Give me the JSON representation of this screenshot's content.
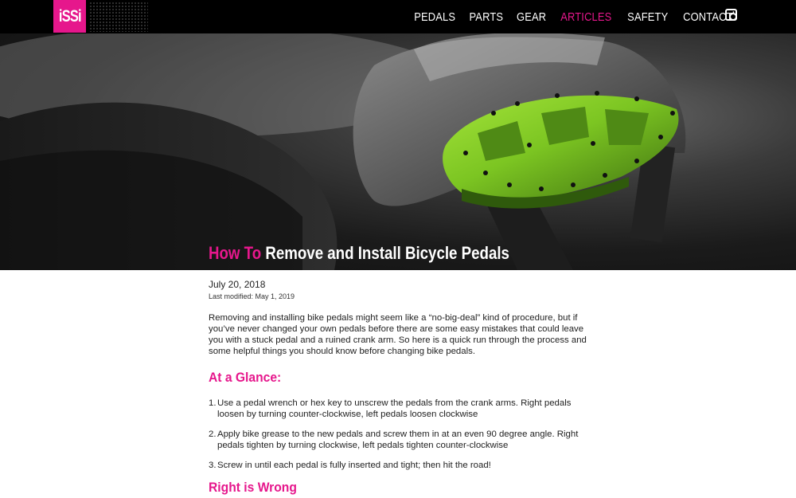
{
  "header": {
    "logo_text": "iSSi",
    "nav": [
      {
        "label": "PEDALS",
        "active": false
      },
      {
        "label": "PARTS",
        "active": false
      },
      {
        "label": "GEAR",
        "active": false
      },
      {
        "label": "ARTICLES",
        "active": true
      },
      {
        "label": "SAFETY",
        "active": false
      },
      {
        "label": "CONTACT",
        "active": false
      }
    ],
    "social_icon": "instagram-icon"
  },
  "hero": {
    "title_prefix": "How To",
    "title": "Remove and Install Bicycle Pedals"
  },
  "article": {
    "date": "July 20, 2018",
    "last_modified": "Last modified: May 1, 2019",
    "intro": "Removing and installing bike pedals might seem like a “no-big-deal” kind of procedure, but if you’ve never changed your own pedals before there are some easy mistakes that could leave you with a stuck pedal and a ruined crank arm. So here is a quick run through the process and some helpful things you should know before changing bike pedals.",
    "at_a_glance_heading": "At a Glance:",
    "steps": [
      {
        "num": "1.",
        "text": "Use a pedal wrench or hex key to unscrew the pedals from the crank arms. Right pedals loosen by turning counter-clockwise, left pedals loosen clockwise"
      },
      {
        "num": "2.",
        "text": "Apply bike grease to the new pedals and screw them in at an even 90 degree angle. Right pedals tighten by turning clockwise, left pedals tighten counter-clockwise"
      },
      {
        "num": "3.",
        "text": "Screw in until each pedal is fully inserted and tight; then hit the road!"
      }
    ],
    "right_is_wrong_heading": "Right is Wrong"
  },
  "colors": {
    "accent": "#e6178c",
    "header_bg": "#000000",
    "pedal_green": "#7cc522"
  }
}
